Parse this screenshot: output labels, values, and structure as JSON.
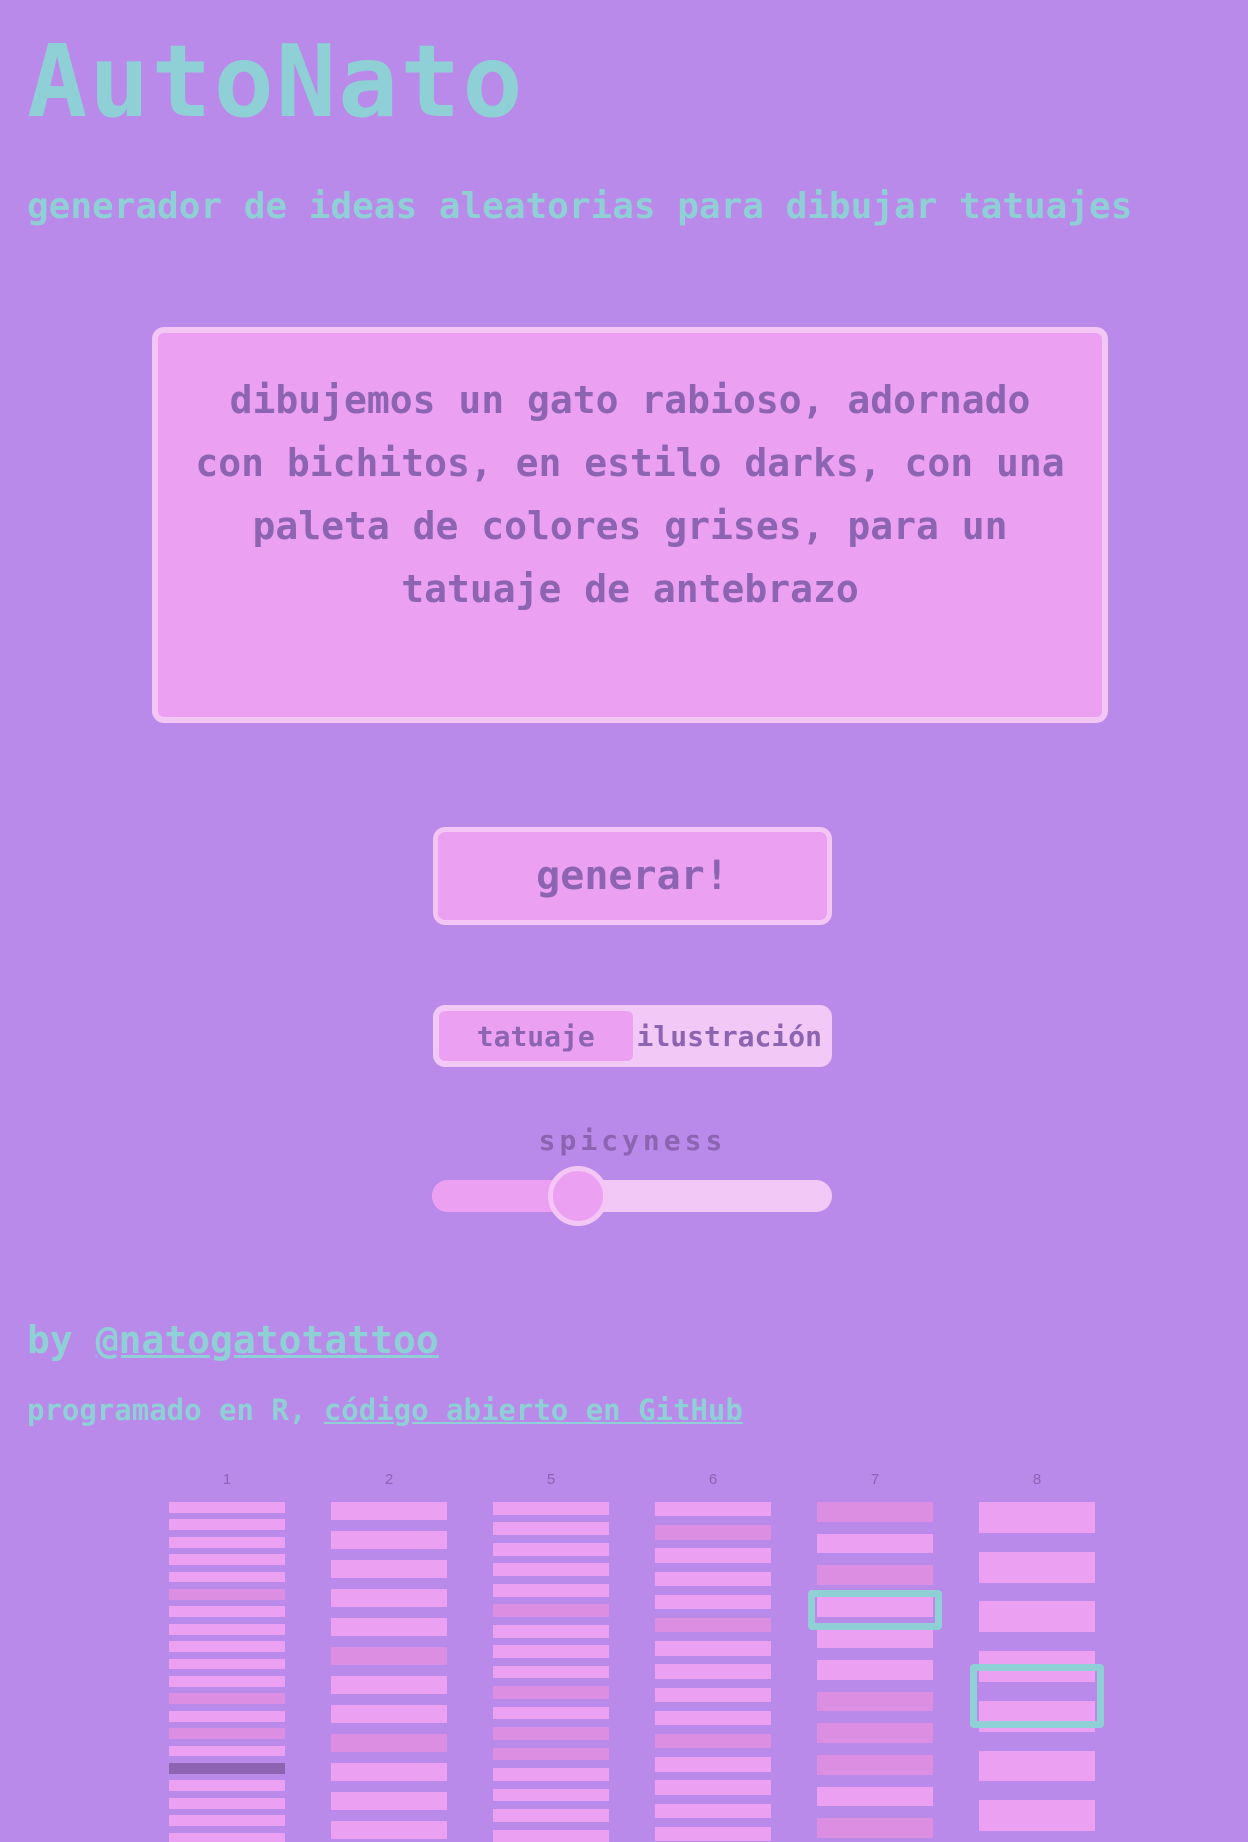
{
  "header": {
    "title": "AutoNato",
    "subtitle": "generador de ideas aleatorias para dibujar tatuajes"
  },
  "idea": {
    "text": "dibujemos un gato rabioso, adornado con bichitos, en estilo darks, con una paleta de colores grises, para un tatuaje de antebrazo"
  },
  "controls": {
    "generate_label": "generar!",
    "mode_options": [
      "tatuaje",
      "ilustración"
    ],
    "mode_selected": "tatuaje",
    "slider_label": "spicyness",
    "slider_value": 0.36
  },
  "footer": {
    "by_prefix": "by ",
    "author_link": "@natogatotattoo",
    "code_prefix": "programado en R, ",
    "code_link": "código abierto en GitHub"
  },
  "columns": [
    {
      "label": "1",
      "count": 20,
      "shaded": [
        5,
        11,
        13
      ],
      "dark": [
        15
      ]
    },
    {
      "label": "2",
      "count": 12,
      "shaded": [
        5,
        8
      ]
    },
    {
      "label": "5",
      "count": 17,
      "shaded": [
        5,
        9,
        11,
        12
      ]
    },
    {
      "label": "6",
      "count": 15,
      "shaded": [
        1,
        5,
        10
      ]
    },
    {
      "label": "7",
      "count": 11,
      "shaded": [
        0,
        2,
        6,
        7,
        8,
        10
      ]
    },
    {
      "label": "8",
      "count": 7,
      "shaded": []
    }
  ],
  "colors": {
    "background": "#b98aea",
    "accent": "#8ed0d5",
    "pink": "#eba0f2",
    "pink_light": "#f4c6f6",
    "text_dark": "#8c64b2"
  }
}
